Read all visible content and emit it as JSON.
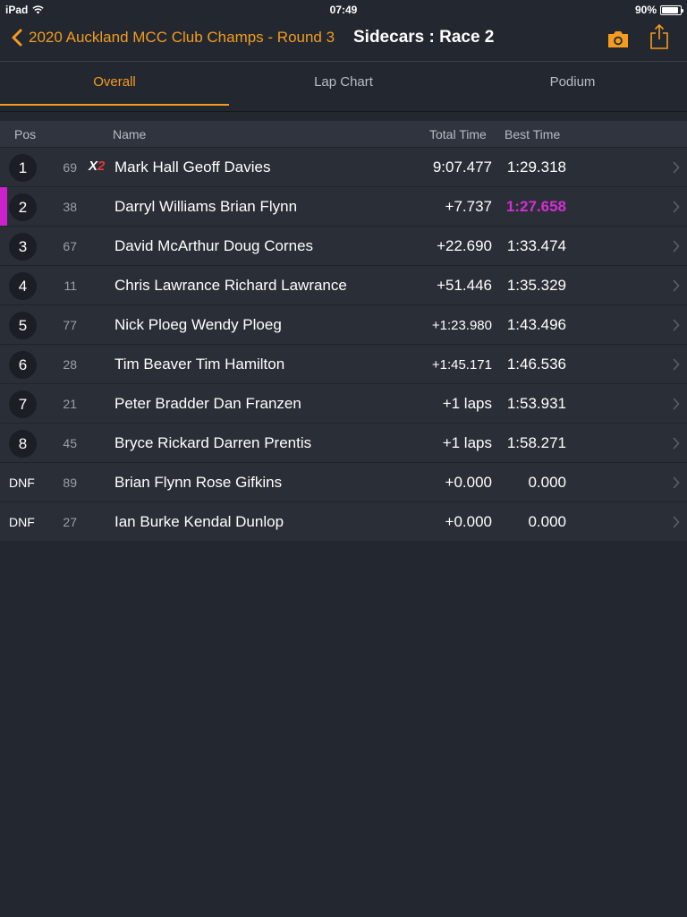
{
  "status": {
    "device": "iPad",
    "time": "07:49",
    "battery": "90%",
    "battery_level": 0.9
  },
  "nav": {
    "back_label": "2020 Auckland MCC Club Champs - Round 3",
    "title": "Sidecars : Race 2",
    "icons": [
      "chevron-left-icon",
      "camera-icon",
      "share-icon"
    ]
  },
  "tabs": [
    {
      "label": "Overall",
      "active": true
    },
    {
      "label": "Lap Chart",
      "active": false
    },
    {
      "label": "Podium",
      "active": false
    }
  ],
  "table": {
    "headers": {
      "pos": "Pos",
      "name": "Name",
      "total": "Total Time",
      "best": "Best Time"
    },
    "rows": [
      {
        "pos": "1",
        "num": "69",
        "badge_x": "X",
        "badge_2": "2",
        "name": "Mark Hall Geoff Davies",
        "total": "9:07.477",
        "best": "1:29.318"
      },
      {
        "pos": "2",
        "num": "38",
        "name": "Darryl Williams Brian Flynn",
        "total": "+7.737",
        "best": "1:27.658",
        "fastest_lap": true
      },
      {
        "pos": "3",
        "num": "67",
        "name": "David McArthur Doug Cornes",
        "total": "+22.690",
        "best": "1:33.474"
      },
      {
        "pos": "4",
        "num": "11",
        "name": "Chris Lawrance Richard Lawrance",
        "total": "+51.446",
        "best": "1:35.329"
      },
      {
        "pos": "5",
        "num": "77",
        "name": "Nick Ploeg Wendy Ploeg",
        "total": "+1:23.980",
        "best": "1:43.496"
      },
      {
        "pos": "6",
        "num": "28",
        "name": "Tim Beaver Tim Hamilton",
        "total": "+1:45.171",
        "best": "1:46.536"
      },
      {
        "pos": "7",
        "num": "21",
        "name": "Peter Bradder Dan Franzen",
        "total": "+1 laps",
        "best": "1:53.931"
      },
      {
        "pos": "8",
        "num": "45",
        "name": "Bryce Rickard Darren Prentis",
        "total": "+1 laps",
        "best": "1:58.271"
      },
      {
        "pos": "DNF",
        "num": "89",
        "name": "Brian Flynn Rose Gifkins",
        "total": "+0.000",
        "best": "0.000"
      },
      {
        "pos": "DNF",
        "num": "27",
        "name": "Ian Burke Kendal Dunlop",
        "total": "+0.000",
        "best": "0.000"
      }
    ]
  },
  "colors": {
    "accent": "#f39c1f",
    "fastest": "#d42fd4",
    "background": "#232730",
    "row": "#2a2e37"
  }
}
